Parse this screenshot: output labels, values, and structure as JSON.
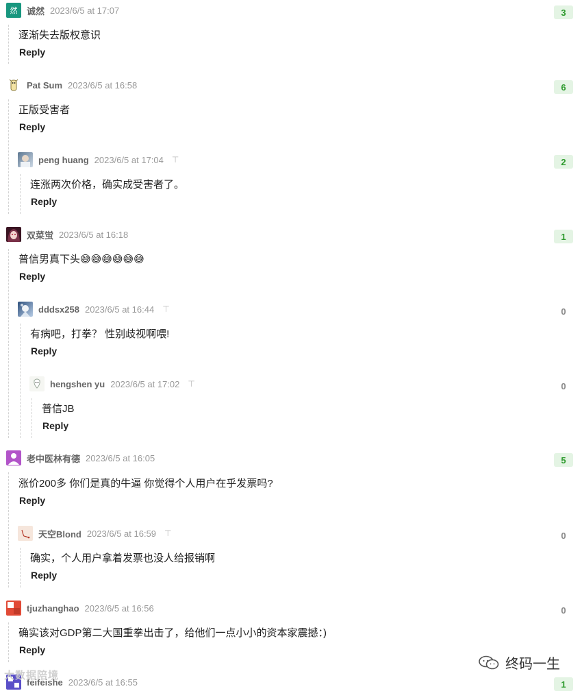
{
  "comments": [
    {
      "author": "诚然",
      "time": "2023/6/5 at 17:07",
      "text": "逐渐失去版权意识",
      "reply": "Reply",
      "votes": "3",
      "avatar_char": "然",
      "avatar_color": "#18977f",
      "pinned": false
    },
    {
      "author": "Pat Sum",
      "time": "2023/6/5 at 16:58",
      "text": "正版受害者",
      "reply": "Reply",
      "votes": "6",
      "avatar_char": "",
      "avatar_color": "#f1e6b8",
      "pinned": false
    },
    {
      "author": "peng huang",
      "time": "2023/6/5 at 17:04",
      "text": "连涨两次价格，确实成受害者了。",
      "reply": "Reply",
      "votes": "2",
      "avatar_char": "",
      "avatar_color": "#8fa9c4",
      "pinned": true
    },
    {
      "author": "双菜蛍",
      "time": "2023/6/5 at 16:18",
      "text": "普信男真下头😅😅😅😅😅😅",
      "reply": "Reply",
      "votes": "1",
      "avatar_char": "",
      "avatar_color": "#7a3148",
      "pinned": false
    },
    {
      "author": "dddsx258",
      "time": "2023/6/5 at 16:44",
      "text": "有病吧，打拳？ 性别歧视啊喂!",
      "reply": "Reply",
      "votes": "0",
      "avatar_char": "",
      "avatar_color": "#6f8fb8",
      "pinned": true
    },
    {
      "author": "hengshen yu",
      "time": "2023/6/5 at 17:02",
      "text": "普信JB",
      "reply": "Reply",
      "votes": "0",
      "avatar_char": "",
      "avatar_color": "#eef1ea",
      "pinned": true
    },
    {
      "author": "老中医林有德",
      "time": "2023/6/5 at 16:05",
      "text": "涨价200多 你们是真的牛逼 你觉得个人用户在乎发票吗?",
      "reply": "Reply",
      "votes": "5",
      "avatar_char": "",
      "avatar_color": "#b254c9",
      "pinned": false
    },
    {
      "author": "天空Blond",
      "time": "2023/6/5 at 16:59",
      "text": "确实，个人用户拿着发票也没人给报销啊",
      "reply": "Reply",
      "votes": "0",
      "avatar_char": "",
      "avatar_color": "#f4ded2",
      "pinned": true
    },
    {
      "author": "tjuzhanghao",
      "time": "2023/6/5 at 16:56",
      "text": "确实该对GDP第二大国重拳出击了，给他们一点小小的资本家震撼：)",
      "reply": "Reply",
      "votes": "0",
      "avatar_char": "",
      "avatar_color": "#e14a36",
      "pinned": false
    },
    {
      "author": "feifeishe",
      "time": "2023/6/5 at 16:55",
      "text": "",
      "reply": "",
      "votes": "1",
      "avatar_char": "",
      "avatar_color": "#5a4fc8",
      "pinned": false
    }
  ],
  "pin_glyph": "⊤",
  "watermark_left": "大数据陪境",
  "watermark_right": "终码一生",
  "colors": {
    "vote_pos_bg": "#e4f4e4",
    "vote_pos_text": "#2e9b2e",
    "thread_line": "#d3d3d3"
  }
}
